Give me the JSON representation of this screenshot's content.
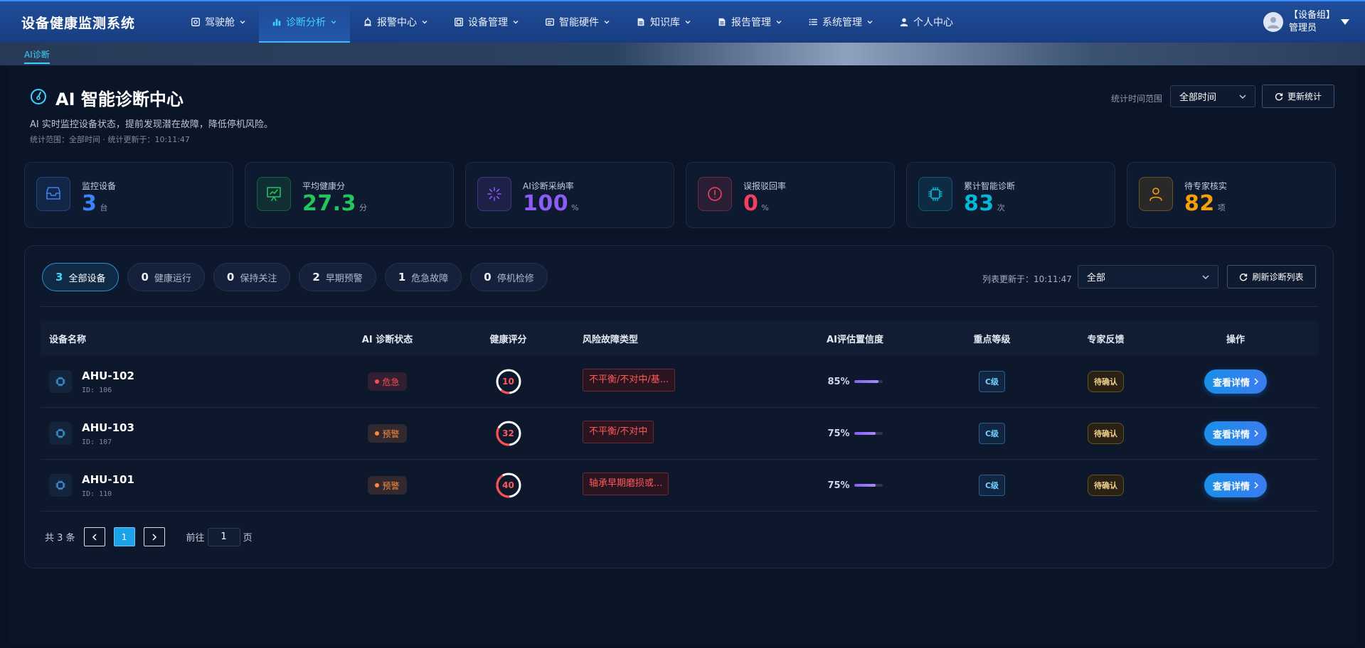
{
  "app": {
    "title": "设备健康监测系统"
  },
  "nav": [
    {
      "label": "驾驶舱",
      "icon": "cockpit-icon"
    },
    {
      "label": "诊断分析",
      "icon": "chart-bar-icon",
      "active": true
    },
    {
      "label": "报警中心",
      "icon": "alarm-icon"
    },
    {
      "label": "设备管理",
      "icon": "device-icon"
    },
    {
      "label": "智能硬件",
      "icon": "hardware-icon"
    },
    {
      "label": "知识库",
      "icon": "book-icon"
    },
    {
      "label": "报告管理",
      "icon": "report-icon"
    },
    {
      "label": "系统管理",
      "icon": "list-icon"
    },
    {
      "label": "个人中心",
      "icon": "user-icon"
    }
  ],
  "user": {
    "group": "【设备组】",
    "role": "管理员"
  },
  "tabs": {
    "current": "AI诊断"
  },
  "header": {
    "title": "AI 智能诊断中心",
    "subtitle": "AI 实时监控设备状态，提前发现潜在故障，降低停机风险。",
    "meta": "统计范围：全部时间 · 统计更新于：10:11:47",
    "range_label": "统计时间范围",
    "range_value": "全部时间",
    "refresh_label": "更新统计"
  },
  "stats": [
    {
      "label": "监控设备",
      "value": "3",
      "unit": "台",
      "color": "#3b82f6",
      "icon": "inbox-icon"
    },
    {
      "label": "平均健康分",
      "value": "27.3",
      "unit": "分",
      "color": "#22c55e",
      "icon": "presentation-chart-icon"
    },
    {
      "label": "AI诊断采纳率",
      "value": "100",
      "unit": "%",
      "color": "#8b5cf6",
      "icon": "loader-icon"
    },
    {
      "label": "误报驳回率",
      "value": "0",
      "unit": "%",
      "color": "#f43f5e",
      "icon": "alert-circle-icon"
    },
    {
      "label": "累计智能诊断",
      "value": "83",
      "unit": "次",
      "color": "#06b6d4",
      "icon": "chip-icon"
    },
    {
      "label": "待专家核实",
      "value": "82",
      "unit": "项",
      "color": "#f59e0b",
      "icon": "person-icon"
    }
  ],
  "filters": [
    {
      "count": "3",
      "label": "全部设备",
      "active": true
    },
    {
      "count": "0",
      "label": "健康运行"
    },
    {
      "count": "0",
      "label": "保持关注"
    },
    {
      "count": "2",
      "label": "早期预警"
    },
    {
      "count": "1",
      "label": "危急故障"
    },
    {
      "count": "0",
      "label": "停机检修"
    }
  ],
  "list": {
    "updated": "列表更新于：10:11:47",
    "select_value": "全部",
    "refresh_label": "刷新诊断列表"
  },
  "table": {
    "headers": [
      "设备名称",
      "AI 诊断状态",
      "健康评分",
      "风险故障类型",
      "AI评估置信度",
      "重点等级",
      "专家反馈",
      "操作"
    ],
    "rows": [
      {
        "name": "AHU-102",
        "id": "ID: 106",
        "status": "危急",
        "status_color": "#ff4d4f",
        "score": 10,
        "risk": "不平衡/不对中/基...",
        "confidence": "85%",
        "confidence_value": 85,
        "level": "C级",
        "feedback": "待确认",
        "action": "查看详情"
      },
      {
        "name": "AHU-103",
        "id": "ID: 107",
        "status": "预警",
        "status_color": "#ff8a3d",
        "score": 32,
        "risk": "不平衡/不对中",
        "confidence": "75%",
        "confidence_value": 75,
        "level": "C级",
        "feedback": "待确认",
        "action": "查看详情"
      },
      {
        "name": "AHU-101",
        "id": "ID: 110",
        "status": "预警",
        "status_color": "#ff8a3d",
        "score": 40,
        "risk": "轴承早期磨损或...",
        "confidence": "75%",
        "confidence_value": 75,
        "level": "C级",
        "feedback": "待确认",
        "action": "查看详情"
      }
    ]
  },
  "pagination": {
    "total": "共 3 条",
    "current": "1",
    "goto_label": "前往",
    "page_input": "1",
    "page_suffix": "页"
  }
}
